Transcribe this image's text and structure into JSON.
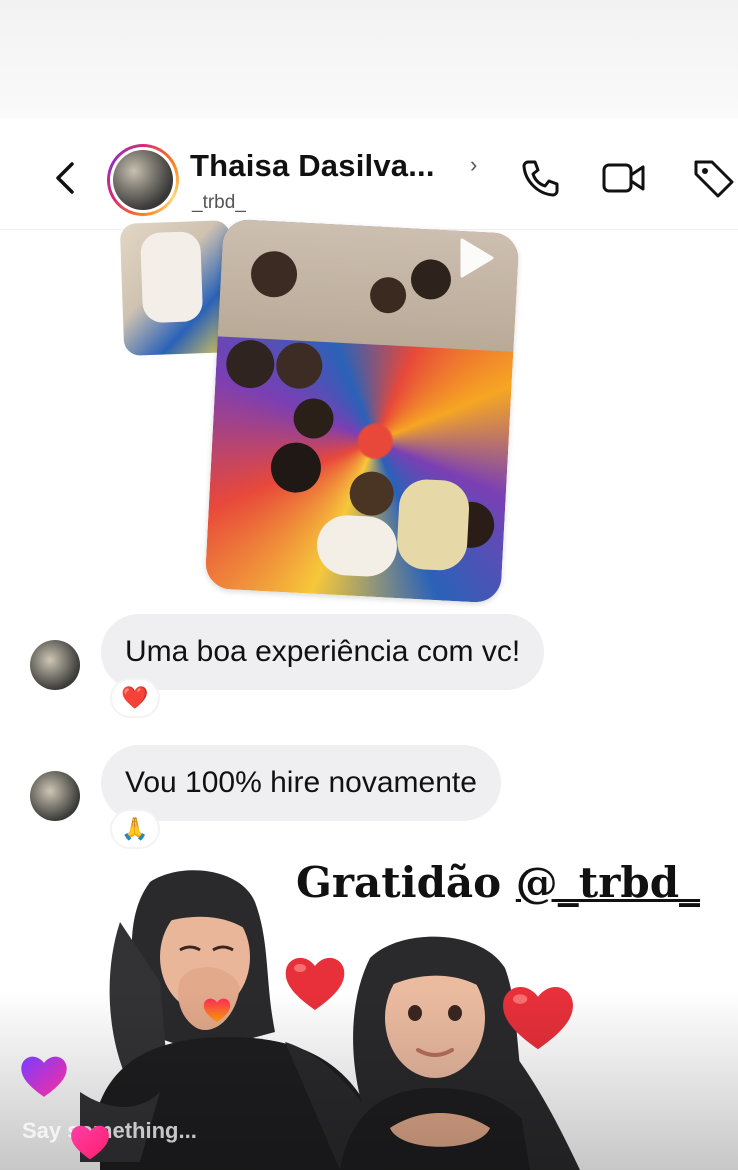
{
  "header": {
    "name": "Thaisa Dasilva...",
    "handle": "_trbd_"
  },
  "messages": [
    {
      "text": "Uma boa experiência com vc!",
      "reaction": "❤️"
    },
    {
      "text": "Vou 100% hire novamente",
      "reaction": "🙏"
    }
  ],
  "overlay": {
    "caption_prefix": "Gratidão ",
    "caption_mention": "@_trbd_"
  },
  "composer": {
    "placeholder": "Say something..."
  },
  "colors": {
    "story_ring": "#d62976",
    "bubble": "#efeff1",
    "heart": "#e8303a"
  }
}
